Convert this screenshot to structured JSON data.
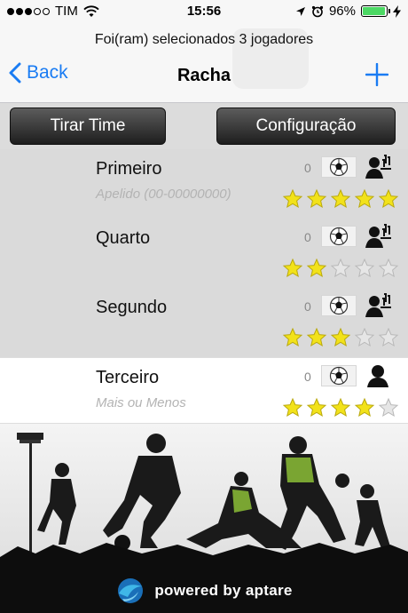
{
  "status_bar": {
    "carrier": "TIM",
    "time": "15:56",
    "battery": "96%",
    "battery_level": 0.96,
    "signal_bars_filled": 3,
    "signal_bars_total": 5
  },
  "nav": {
    "prompt": "Foi(ram) selecionados 3 jogadores",
    "back_label": "Back",
    "title": "Racha",
    "add_icon": "plus-icon",
    "accent_color": "#1a7cf3"
  },
  "toolbar": {
    "left_label": "Tirar Time",
    "right_label": "Configuração"
  },
  "players": [
    {
      "name": "Primeiro",
      "subtitle": "Apelido (00-00000000)",
      "count": "0",
      "rating": 5,
      "selected": true
    },
    {
      "name": "Quarto",
      "subtitle": "",
      "count": "0",
      "rating": 2,
      "selected": true
    },
    {
      "name": "Segundo",
      "subtitle": "",
      "count": "0",
      "rating": 3,
      "selected": true
    },
    {
      "name": "Terceiro",
      "subtitle": "Mais ou Menos",
      "count": "0",
      "rating": 4,
      "selected": false
    }
  ],
  "footer": {
    "powered_text": "powered by aptare",
    "logo_icon": "aptare-logo-icon"
  },
  "colors": {
    "star_filled": "#f2e21a",
    "star_empty": "#e6e6e6",
    "selected_row": "#dadada"
  }
}
